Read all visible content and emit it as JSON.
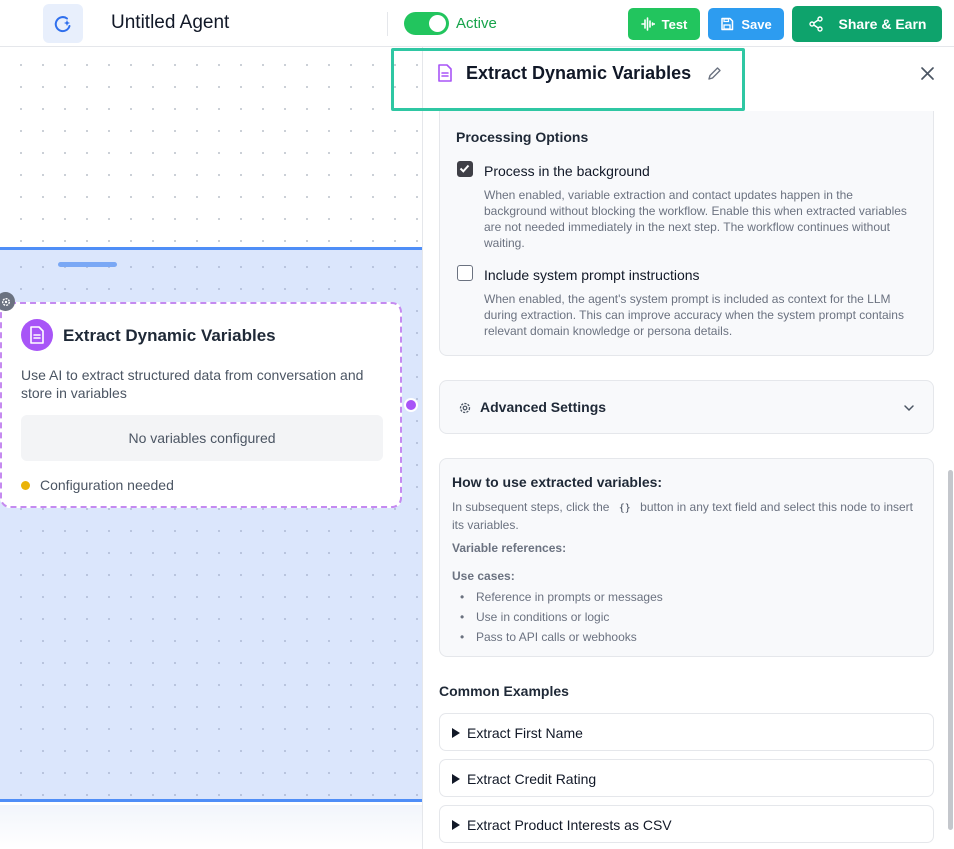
{
  "header": {
    "agent_title": "Untitled Agent",
    "status_label": "Active",
    "status_on": true,
    "test_label": "Test",
    "save_label": "Save",
    "share_label": "Share & Earn"
  },
  "node": {
    "title": "Extract Dynamic Variables",
    "description": "Use AI to extract structured data from conversation and store in variables",
    "empty_state": "No variables configured",
    "status": "Configuration needed"
  },
  "panel": {
    "title": "Extract Dynamic Variables",
    "processing": {
      "title": "Processing Options",
      "options": [
        {
          "label": "Process in the background",
          "checked": true,
          "description": "When enabled, variable extraction and contact updates happen in the background without blocking the workflow. Enable this when extracted variables are not needed immediately in the next step. The workflow continues without waiting."
        },
        {
          "label": "Include system prompt instructions",
          "checked": false,
          "description": "When enabled, the agent's system prompt is included as context for the LLM during extraction. This can improve accuracy when the system prompt contains relevant domain knowledge or persona details."
        }
      ]
    },
    "advanced_label": "Advanced Settings",
    "howto": {
      "title": "How to use extracted variables:",
      "text_before": "In subsequent steps, click the",
      "code_chip": "{}",
      "text_after": "button in any text field and select this node to insert its variables.",
      "variable_refs_label": "Variable references:",
      "use_cases_label": "Use cases:",
      "use_cases": [
        "Reference in prompts or messages",
        "Use in conditions or logic",
        "Pass to API calls or webhooks"
      ]
    },
    "examples_title": "Common Examples",
    "examples": [
      "Extract First Name",
      "Extract Credit Rating",
      "Extract Product Interests as CSV"
    ]
  },
  "colors": {
    "accent_green": "#22c55e",
    "save_blue": "#2d9cf0",
    "share_green": "#0ea36c",
    "node_purple": "#a855f7",
    "highlight_teal": "#2fc7a3",
    "status_yellow": "#eab308"
  }
}
